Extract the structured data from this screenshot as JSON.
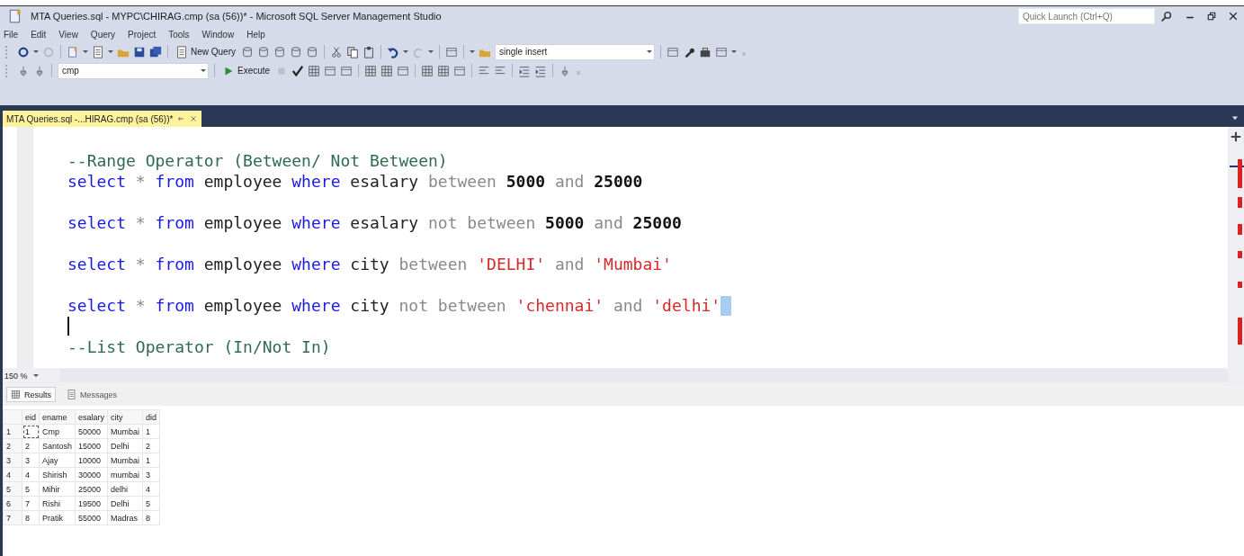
{
  "window": {
    "title": "MTA Queries.sql - MYPC\\CHIRAG.cmp (sa (56))* - Microsoft SQL Server Management Studio",
    "quick_launch": {
      "placeholder": "Quick Launch (Ctrl+Q)"
    }
  },
  "menu": [
    "File",
    "Edit",
    "View",
    "Query",
    "Project",
    "Tools",
    "Window",
    "Help"
  ],
  "toolbar": {
    "new_query": "New Query",
    "configuration": "single insert"
  },
  "sql_toolbar": {
    "database": "cmp",
    "execute": "Execute"
  },
  "tabs": [
    {
      "label": "MTA Queries.sql -...HIRAG.cmp (sa (56))*",
      "selected": true
    }
  ],
  "editor": {
    "lines": [
      {
        "tokens": [
          {
            "kind": "comment",
            "text": "--Range Operator (Between/ Not Between)"
          }
        ]
      },
      {
        "tokens": [
          {
            "kind": "keyword",
            "text": "select"
          },
          {
            "kind": "operator",
            "text": " * "
          },
          {
            "kind": "keyword",
            "text": "from"
          },
          {
            "kind": "plain",
            "text": " employee "
          },
          {
            "kind": "keyword",
            "text": "where"
          },
          {
            "kind": "plain",
            "text": " esalary "
          },
          {
            "kind": "operator",
            "text": "between"
          },
          {
            "kind": "number",
            "text": " 5000 "
          },
          {
            "kind": "operator",
            "text": "and"
          },
          {
            "kind": "number",
            "text": " 25000"
          }
        ]
      },
      {
        "blank_line_before": true,
        "tokens": [
          {
            "kind": "keyword",
            "text": "select"
          },
          {
            "kind": "operator",
            "text": " * "
          },
          {
            "kind": "keyword",
            "text": "from"
          },
          {
            "kind": "plain",
            "text": " employee "
          },
          {
            "kind": "keyword",
            "text": "where"
          },
          {
            "kind": "plain",
            "text": " esalary "
          },
          {
            "kind": "operator",
            "text": "not between"
          },
          {
            "kind": "number",
            "text": " 5000 "
          },
          {
            "kind": "operator",
            "text": "and"
          },
          {
            "kind": "number",
            "text": " 25000"
          }
        ]
      },
      {
        "blank_line_before": true,
        "tokens": [
          {
            "kind": "keyword",
            "text": "select"
          },
          {
            "kind": "operator",
            "text": " * "
          },
          {
            "kind": "keyword",
            "text": "from"
          },
          {
            "kind": "plain",
            "text": " employee "
          },
          {
            "kind": "keyword",
            "text": "where"
          },
          {
            "kind": "plain",
            "text": " city "
          },
          {
            "kind": "operator",
            "text": "between "
          },
          {
            "kind": "string",
            "text": "'DELHI'"
          },
          {
            "kind": "operator",
            "text": " and "
          },
          {
            "kind": "string",
            "text": "'Mumbai'"
          }
        ]
      },
      {
        "blank_line_before": true,
        "tokens": [
          {
            "kind": "keyword",
            "text": "select"
          },
          {
            "kind": "operator",
            "text": " * "
          },
          {
            "kind": "keyword",
            "text": "from"
          },
          {
            "kind": "plain",
            "text": " employee "
          },
          {
            "kind": "keyword",
            "text": "where"
          },
          {
            "kind": "plain",
            "text": " city "
          },
          {
            "kind": "operator",
            "text": "not between "
          },
          {
            "kind": "string",
            "text": "'chennai'"
          },
          {
            "kind": "operator",
            "text": " and "
          },
          {
            "kind": "string",
            "text": "'delhi'"
          }
        ],
        "highlight_end": true
      },
      {
        "cursor": true
      },
      {
        "tokens": [
          {
            "kind": "comment",
            "text": "--List Operator (In/Not In)"
          }
        ]
      }
    ]
  },
  "zoom": "150 %",
  "result_tabs": [
    {
      "label": "Results",
      "selected": true
    },
    {
      "label": "Messages",
      "selected": false
    }
  ],
  "results": {
    "columns": [
      "eid",
      "ename",
      "esalary",
      "city",
      "did"
    ],
    "rows": [
      {
        "number": "1",
        "cells": [
          "1",
          "Cmp",
          "50000",
          "Mumbai",
          "1"
        ],
        "focused": true
      },
      {
        "number": "2",
        "cells": [
          "2",
          "Santosh",
          "15000",
          "Delhi",
          "2"
        ],
        "focused": false
      },
      {
        "number": "3",
        "cells": [
          "3",
          "Ajay",
          "10000",
          "Mumbai",
          "1"
        ],
        "focused": false
      },
      {
        "number": "4",
        "cells": [
          "4",
          "Shirish",
          "30000",
          "mumbai",
          "3"
        ],
        "focused": false
      },
      {
        "number": "5",
        "cells": [
          "5",
          "Mihir",
          "25000",
          "delhi",
          "4"
        ],
        "focused": false
      },
      {
        "number": "6",
        "cells": [
          "7",
          "Rishi",
          "19500",
          "Delhi",
          "5"
        ],
        "focused": false
      },
      {
        "number": "7",
        "cells": [
          "8",
          "Pratik",
          "55000",
          "Madras",
          "8"
        ],
        "focused": false
      }
    ]
  }
}
